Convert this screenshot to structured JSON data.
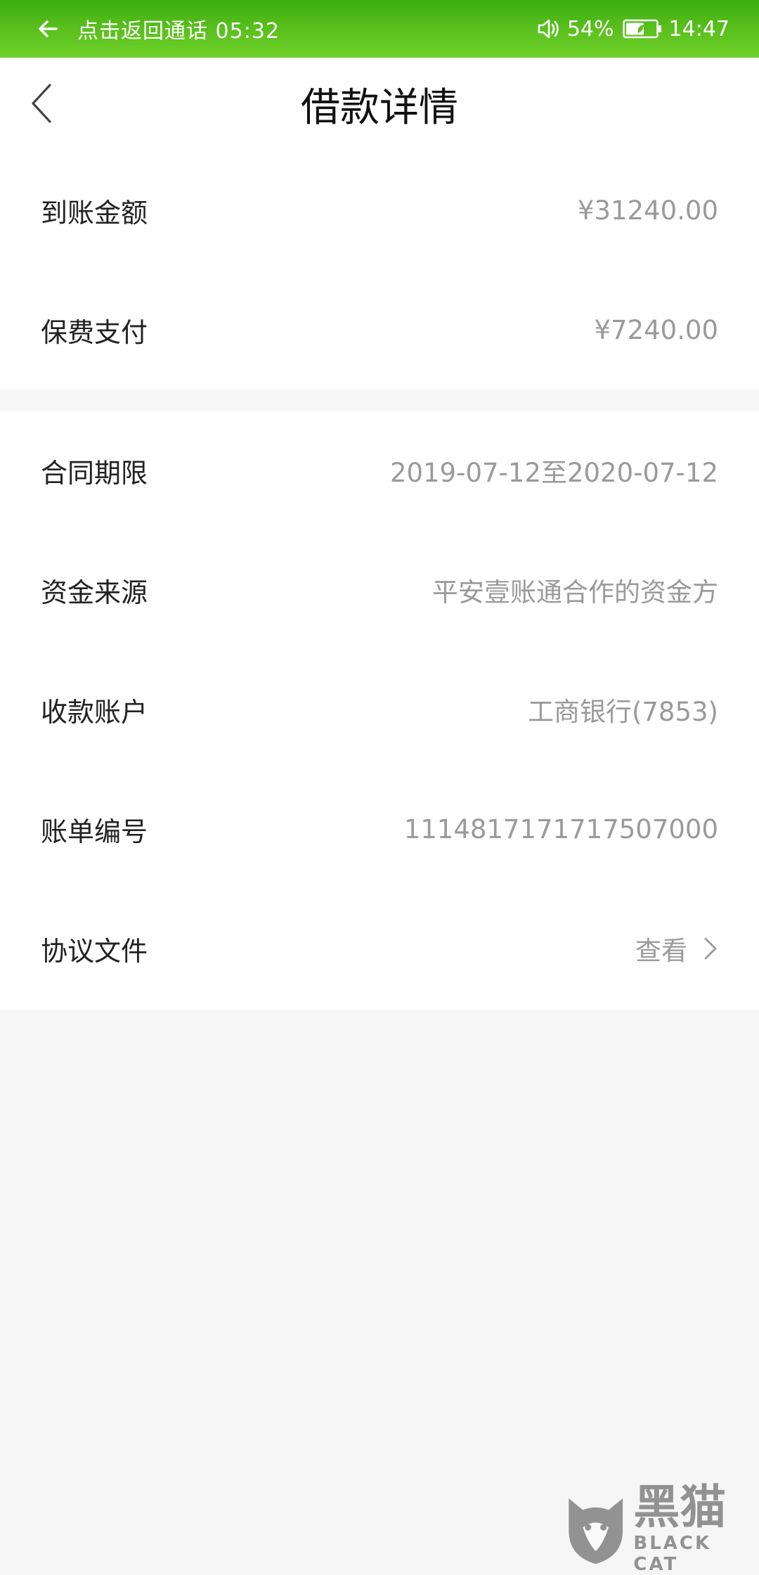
{
  "status_bar": {
    "call_return_text": "点击返回通话 05:32",
    "battery_percent": "54%",
    "time": "14:47"
  },
  "header": {
    "title": "借款详情",
    "back_icon": "chevron-left-icon"
  },
  "section1": [
    {
      "label": "到账金额",
      "value": "¥31240.00"
    },
    {
      "label": "保费支付",
      "value": "¥7240.00"
    }
  ],
  "section2": [
    {
      "label": "合同期限",
      "value": "2019-07-12至2020-07-12"
    },
    {
      "label": "资金来源",
      "value": "平安壹账通合作的资金方"
    },
    {
      "label": "收款账户",
      "value": "工商银行(7853)"
    },
    {
      "label": "账单编号",
      "value": "1114817171717507000"
    },
    {
      "label": "协议文件",
      "value": "查看"
    }
  ],
  "watermark": {
    "cn": "黑猫",
    "en": "BLACK CAT"
  },
  "colors": {
    "status_bar": "#5cc11e",
    "background": "#f6f6f6",
    "card": "#ffffff",
    "label": "#222222",
    "value": "#9a9a9a"
  }
}
